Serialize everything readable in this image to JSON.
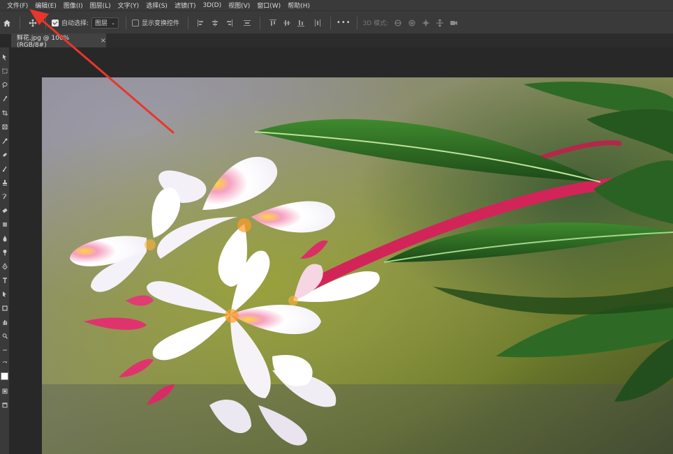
{
  "menubar": {
    "items": [
      "文件(F)",
      "编辑(E)",
      "图像(I)",
      "图层(L)",
      "文字(Y)",
      "选择(S)",
      "滤镜(T)",
      "3D(D)",
      "视图(V)",
      "窗口(W)",
      "帮助(H)"
    ]
  },
  "options": {
    "auto_select_label": "自动选择:",
    "auto_select_checked": true,
    "layer_select": "图层",
    "show_transform_label": "显示变换控件",
    "show_transform_checked": false,
    "more_label": "•••",
    "mode_3d_label": "3D 模式:"
  },
  "tab": {
    "title": "鲜花.jpg @ 100%(RGB/8#)",
    "close": "×"
  },
  "icons": {
    "home": "home-icon",
    "move": "move-icon",
    "annotation": "red-arrow-annotation"
  },
  "colors": {
    "annotation_red": "#e8362c",
    "chrome": "#3a3a3a",
    "workspace": "#282828"
  }
}
